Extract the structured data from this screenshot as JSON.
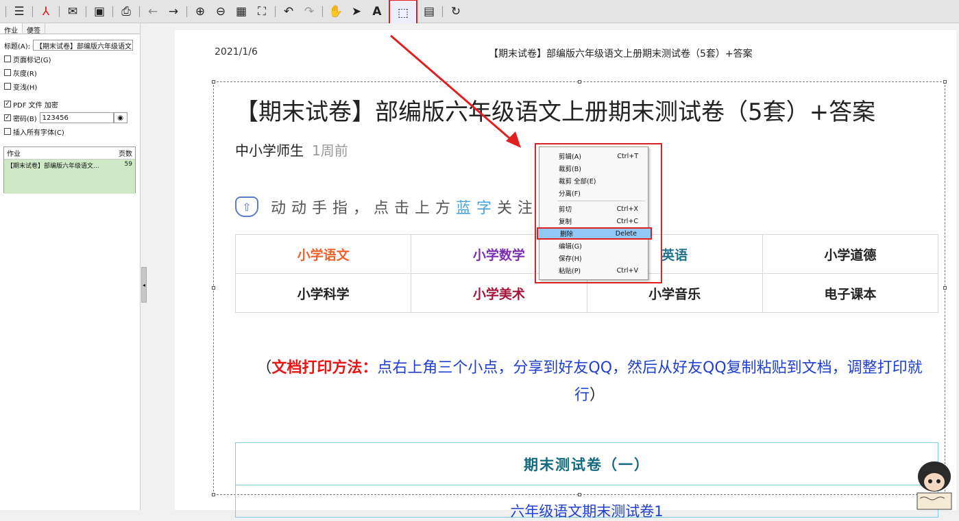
{
  "toolbar": {
    "icons": [
      "menu-icon",
      "pdf-icon",
      "mail-icon",
      "save-icon",
      "print-icon",
      "back-icon",
      "forward-icon",
      "zoom-in-icon",
      "zoom-out-icon",
      "grid-icon",
      "fit-icon",
      "undo-icon",
      "redo-icon",
      "hand-icon",
      "pointer-icon",
      "text-icon",
      "select-region-icon",
      "page-icon",
      "refresh-icon"
    ]
  },
  "sidebar": {
    "tabs": [
      "作业",
      "便签"
    ],
    "title_label": "标题(A):",
    "title_value": "【期末试卷】部编版六年级语文...",
    "options": [
      {
        "label": "页面标记(G)",
        "checked": false
      },
      {
        "label": "灰度(R)",
        "checked": false
      },
      {
        "label": "变浅(H)",
        "checked": false
      }
    ],
    "pdf_encrypt": {
      "label": "PDF 文件 加密",
      "checked": true
    },
    "password": {
      "label": "密码(B)",
      "value": "123456",
      "checked": true
    },
    "embed_fonts": {
      "label": "插入所有字体(C)",
      "checked": false
    },
    "job_list": {
      "col_job": "作业",
      "col_pages": "页数",
      "job_name": "【期末试卷】部编版六年级语文...",
      "job_pages": "59"
    }
  },
  "page": {
    "header_date": "2021/1/6",
    "header_title": "【期末试卷】部编版六年级语文上册期末测试卷（5套）+答案",
    "doc_title": "【期末试卷】部编版六年级语文上册期末测试卷（5套）+答案",
    "author": "中小学师生",
    "time_ago": "1周前",
    "banner_text": "动动手指，点击上方",
    "banner_blue": "蓝字",
    "banner_tail": "关注",
    "grid": [
      [
        {
          "t": "小学语文",
          "c": "#f0612a"
        },
        {
          "t": "小学数学",
          "c": "#7b2fb0"
        },
        {
          "t": "英语",
          "c": "#1e6f8a"
        },
        {
          "t": "小学道德",
          "c": "#222222"
        }
      ],
      [
        {
          "t": "小学科学",
          "c": "#222222"
        },
        {
          "t": "小学美术",
          "c": "#a5153a"
        },
        {
          "t": "小学音乐",
          "c": "#222222"
        },
        {
          "t": "电子课本",
          "c": "#222222"
        }
      ]
    ],
    "note_open": "（",
    "note_red": "文档打印方法：",
    "note_body": "点右上角三个小点，分享到好友QQ，然后从好友QQ复制粘贴到文档，调整打印就行",
    "note_close": "）",
    "section_title": "期末测试卷（一）",
    "section_sub": "六年级语文期末测试卷1"
  },
  "context_menu": {
    "items": [
      {
        "label": "剪辑(A)",
        "shortcut": "Ctrl+T"
      },
      {
        "label": "裁剪(B)",
        "shortcut": ""
      },
      {
        "label": "裁剪 全部(E)",
        "shortcut": ""
      },
      {
        "label": "分离(F)",
        "shortcut": ""
      },
      {
        "sep": true
      },
      {
        "label": "剪切",
        "shortcut": "Ctrl+X"
      },
      {
        "label": "复制",
        "shortcut": "Ctrl+C"
      },
      {
        "label": "删除",
        "shortcut": "Delete",
        "highlight": true
      },
      {
        "label": "编辑(G)",
        "shortcut": ""
      },
      {
        "label": "保存(H)",
        "shortcut": ""
      },
      {
        "label": "粘贴(P)",
        "shortcut": "Ctrl+V"
      }
    ]
  },
  "colors": {
    "annotation_red": "#e02020",
    "menu_highlight": "#91c8f6"
  }
}
